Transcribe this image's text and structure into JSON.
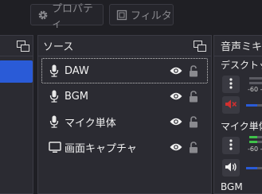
{
  "toolbar": {
    "properties_label": "プロパティ",
    "filters_label": "フィルタ"
  },
  "sources_dock": {
    "title": "ソース",
    "items": [
      {
        "label": "DAW",
        "icon": "microphone-icon",
        "visible": true,
        "locked": false,
        "selected": true
      },
      {
        "label": "BGM",
        "icon": "microphone-icon",
        "visible": true,
        "locked": false,
        "selected": false
      },
      {
        "label": "マイク単体",
        "icon": "microphone-icon",
        "visible": true,
        "locked": false,
        "selected": false
      },
      {
        "label": "画面キャプチャ",
        "icon": "monitor-icon",
        "visible": true,
        "locked": false,
        "selected": false
      }
    ]
  },
  "mixer_dock": {
    "title": "音声ミキサ",
    "channels": [
      {
        "name": "デスクトップ",
        "muted": true,
        "scale": "-60 -5"
      },
      {
        "name": "マイク単体",
        "muted": false,
        "scale": "-60 -5"
      },
      {
        "name": "BGM"
      }
    ]
  },
  "colors": {
    "accent": "#2a5bd7",
    "muted_red": "#d03030",
    "meter_green": "#3fc24a",
    "dock_bg": "#2b2b32",
    "app_bg": "#1f1f24"
  }
}
